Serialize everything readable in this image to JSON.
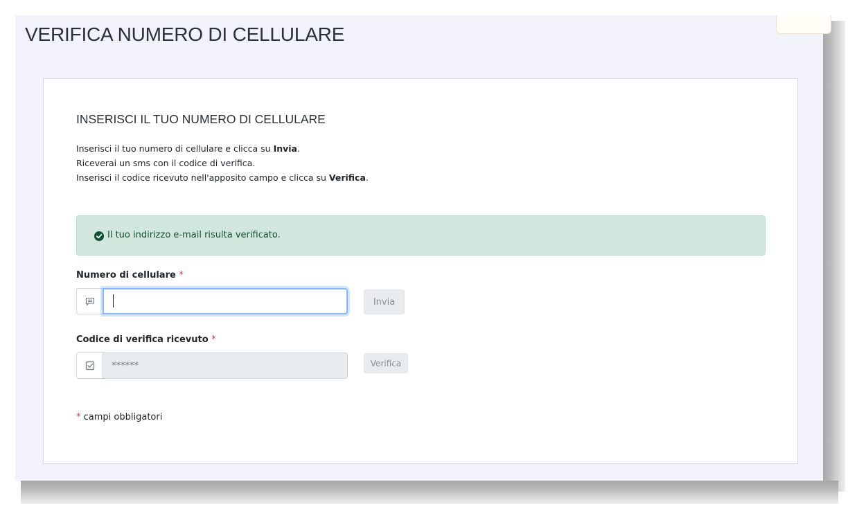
{
  "page": {
    "title": "VERIFICA NUMERO DI CELLULARE"
  },
  "section": {
    "title": "INSERISCI IL TUO NUMERO DI CELLULARE",
    "line1_pre": "Inserisci il tuo numero di cellulare e clicca su ",
    "line1_bold": "Invia",
    "line1_post": ".",
    "line2": "Riceverai un sms con il codice di verifica.",
    "line3_pre": "Inserisci il codice ricevuto nell'apposito campo e clicca su ",
    "line3_bold": "Verifica",
    "line3_post": "."
  },
  "alert": {
    "icon": "check-circle-icon",
    "text": "Il tuo indirizzo e-mail risulta verificato.",
    "color": "#d1e7dd"
  },
  "phone_field": {
    "label": "Numero di cellulare",
    "required_mark": "*",
    "icon": "message-icon",
    "value": "",
    "button_label": "Invia"
  },
  "code_field": {
    "label": "Codice di verifica ricevuto",
    "required_mark": "*",
    "icon": "checkbox-icon",
    "placeholder": "******",
    "button_label": "Verifica"
  },
  "footer": {
    "required_mark": "*",
    "note": "campi obbligatori"
  },
  "colors": {
    "page_background": "#f2f3fa",
    "required": "#dc3545",
    "focus_border": "#86b7fe"
  }
}
